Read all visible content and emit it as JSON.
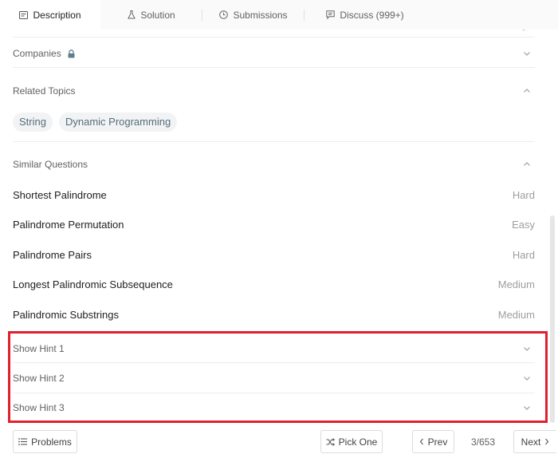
{
  "tabs": [
    {
      "label": "Description",
      "icon": "description-icon",
      "active": true
    },
    {
      "label": "Solution",
      "icon": "flask-icon",
      "active": false
    },
    {
      "label": "Submissions",
      "icon": "clock-icon",
      "active": false
    },
    {
      "label": "Discuss (999+)",
      "icon": "comment-icon",
      "active": false
    }
  ],
  "companies": {
    "label": "Companies",
    "icon": "lock-icon"
  },
  "related_topics": {
    "label": "Related Topics",
    "tags": [
      "String",
      "Dynamic Programming"
    ]
  },
  "similar_questions": {
    "label": "Similar Questions",
    "items": [
      {
        "title": "Shortest Palindrome",
        "difficulty": "Hard"
      },
      {
        "title": "Palindrome Permutation",
        "difficulty": "Easy"
      },
      {
        "title": "Palindrome Pairs",
        "difficulty": "Hard"
      },
      {
        "title": "Longest Palindromic Subsequence",
        "difficulty": "Medium"
      },
      {
        "title": "Palindromic Substrings",
        "difficulty": "Medium"
      }
    ]
  },
  "hints": [
    "Show Hint 1",
    "Show Hint 2",
    "Show Hint 3"
  ],
  "footer": {
    "problems_label": "Problems",
    "pick_one_label": "Pick One",
    "prev_label": "Prev",
    "page_count": "3/653",
    "next_label": "Next"
  },
  "colors": {
    "highlight": "#e0202d",
    "tag_bg": "#f2f3f4",
    "tag_text": "#546e7a"
  }
}
